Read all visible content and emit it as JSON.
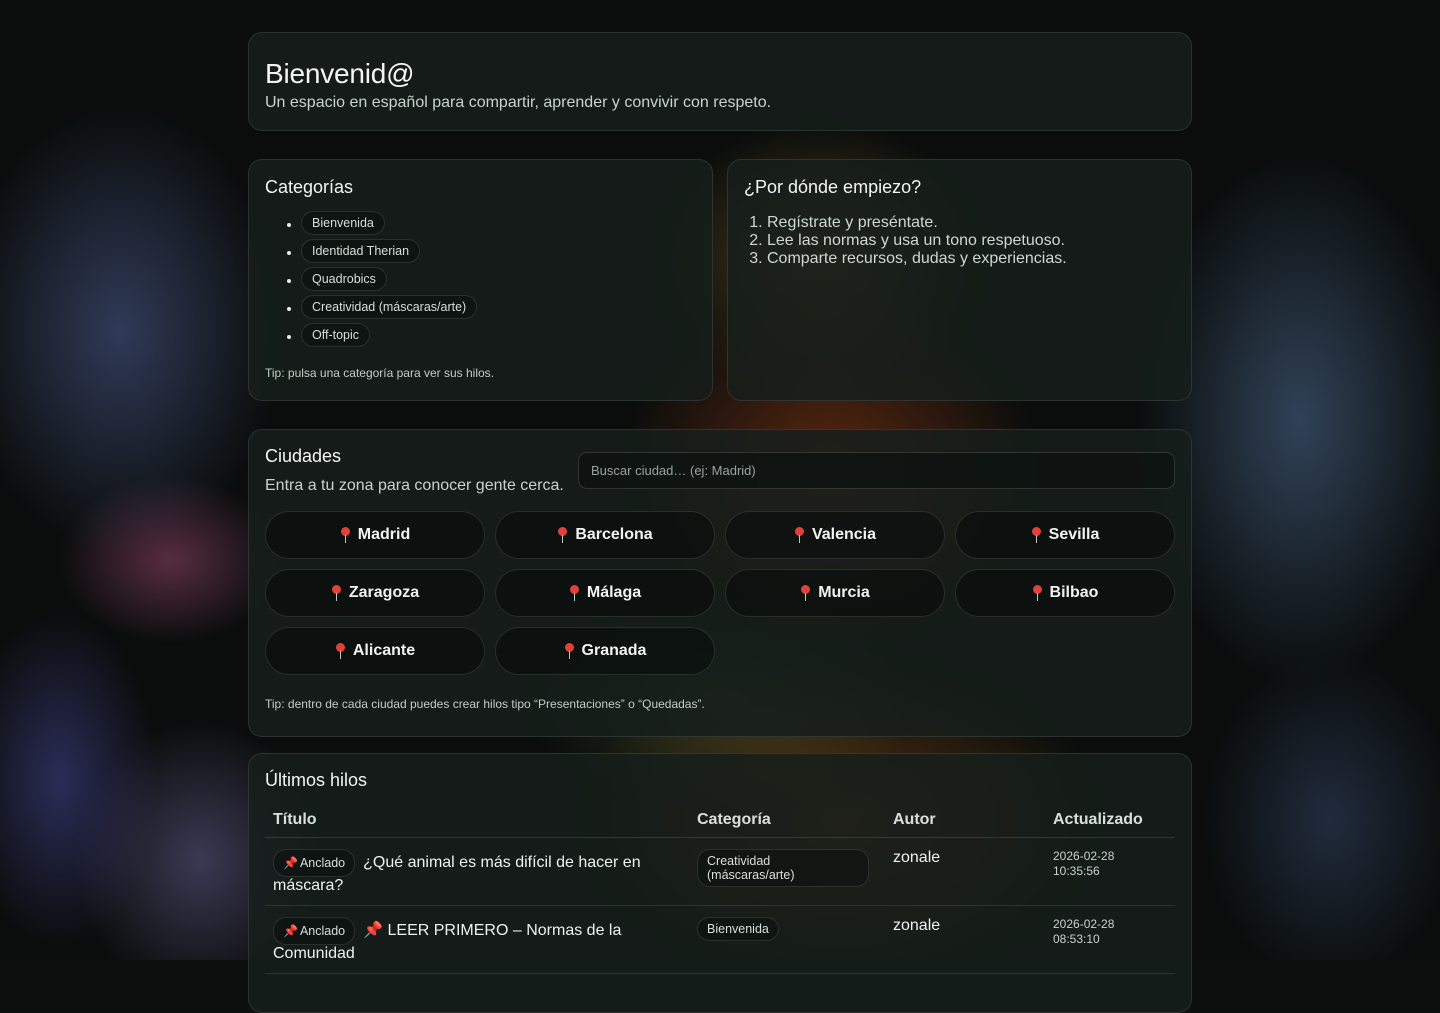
{
  "hero": {
    "title": "Bienvenid@",
    "subtitle": "Un espacio en español para compartir, aprender y convivir con respeto."
  },
  "categories": {
    "title": "Categorías",
    "items": [
      "Bienvenida",
      "Identidad Therian",
      "Quadrobics",
      "Creatividad (máscaras/arte)",
      "Off-topic"
    ],
    "tip": "Tip: pulsa una categoría para ver sus hilos."
  },
  "start": {
    "title": "¿Por dónde empiezo?",
    "steps": [
      "Regístrate y preséntate.",
      "Lee las normas y usa un tono respetuoso.",
      "Comparte recursos, dudas y experiencias."
    ]
  },
  "cities": {
    "title": "Ciudades",
    "subtitle": "Entra a tu zona para conocer gente cerca.",
    "search_placeholder": "Buscar ciudad… (ej: Madrid)",
    "items": [
      "Madrid",
      "Barcelona",
      "Valencia",
      "Sevilla",
      "Zaragoza",
      "Málaga",
      "Murcia",
      "Bilbao",
      "Alicante",
      "Granada"
    ],
    "tip": "Tip: dentro de cada ciudad puedes crear hilos tipo “Presentaciones” o “Quedadas”.",
    "pin_icon": "round-pushpin-icon"
  },
  "threads": {
    "title": "Últimos hilos",
    "columns": [
      "Título",
      "Categoría",
      "Autor",
      "Actualizado"
    ],
    "rows": [
      {
        "badge": "Anclado",
        "title": "¿Qué animal es más difícil de hacer en máscara?",
        "category": "Creatividad (máscaras/arte)",
        "author": "zonale",
        "date": "2026-02-28",
        "time": "10:35:56"
      },
      {
        "badge": "Anclado",
        "title": "📌 LEER PRIMERO – Normas de la Comunidad",
        "category": "Bienvenida",
        "author": "zonale",
        "date": "2026-02-28",
        "time": "08:53:10"
      }
    ]
  },
  "colors": {
    "background": "#0b0f0e",
    "card": "#161e1b",
    "pin": "#e2413a"
  }
}
